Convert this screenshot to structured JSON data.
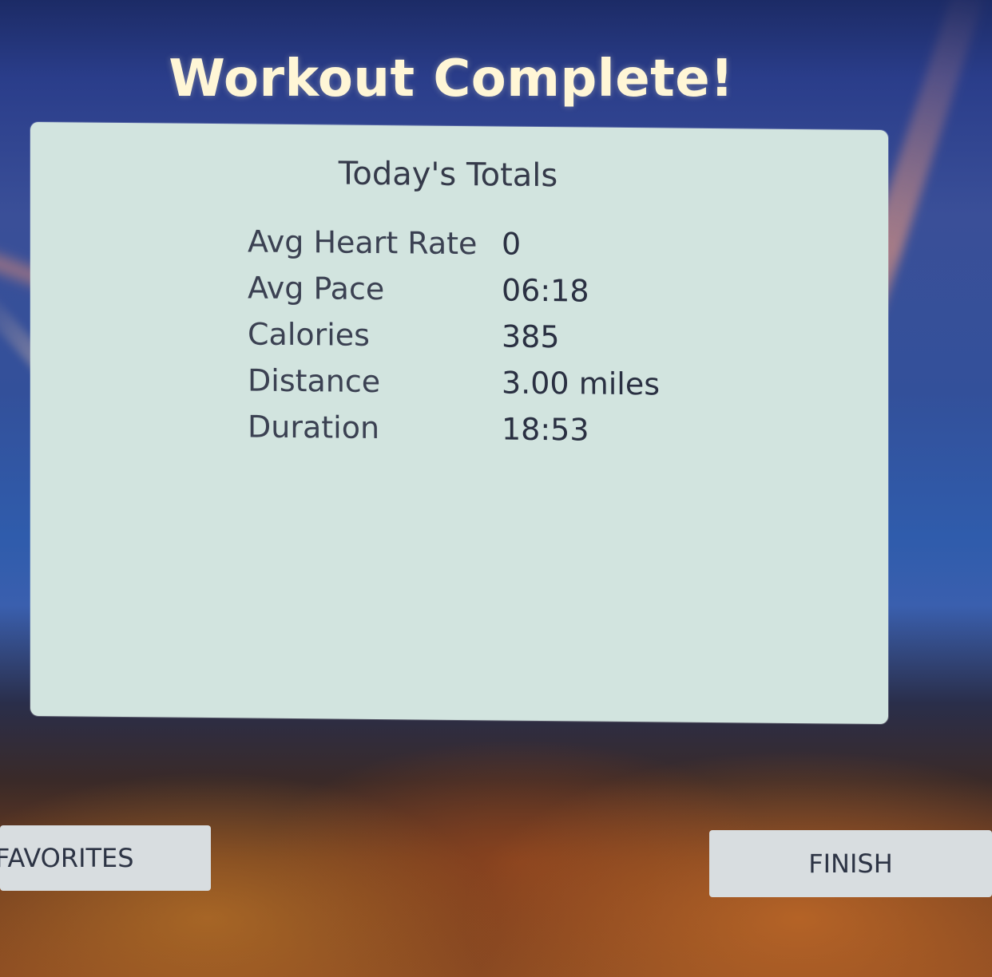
{
  "header": {
    "title": "Workout Complete!"
  },
  "summary": {
    "heading": "Today's Totals",
    "stats": [
      {
        "label": "Avg Heart Rate",
        "value": "0"
      },
      {
        "label": "Avg Pace",
        "value": "06:18"
      },
      {
        "label": "Calories",
        "value": "385"
      },
      {
        "label": "Distance",
        "value": "3.00 miles"
      },
      {
        "label": "Duration",
        "value": "18:53"
      }
    ]
  },
  "buttons": {
    "favorites_label": "FAVORITES",
    "finish_label": "FINISH"
  },
  "colors": {
    "title_text": "#fff6d6",
    "panel_background": "#d2e4df",
    "button_background": "#d8dde0"
  }
}
